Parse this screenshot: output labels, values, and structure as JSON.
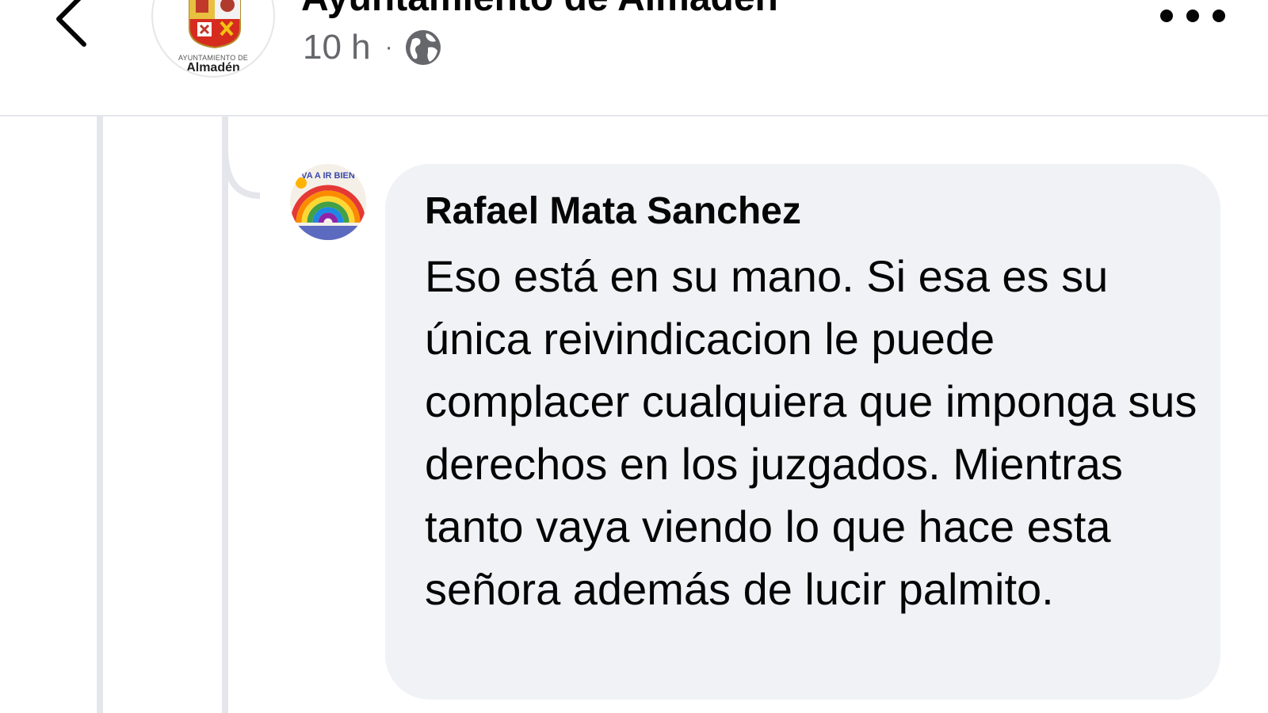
{
  "header": {
    "page_name": "Ayuntamiento de Almadén",
    "logo_caption_small": "AYUNTAMIENTO DE",
    "logo_caption_main": "Almadén",
    "time_ago": "10 h",
    "separator": "·",
    "audience_icon": "globe-icon",
    "back_icon": "chevron-left-icon",
    "more_icon": "more-horizontal-icon"
  },
  "comment": {
    "author": "Rafael Mata Sanchez",
    "text": "Eso está en su mano. Si esa es su única reivindicacion le puede complacer cualquiera que imponga sus derechos en los juzgados. Mientras tanto vaya viendo lo que hace esta señora además de lucir palmito.",
    "avatar_caption": "VA A IR BIEN"
  },
  "colors": {
    "bubble": "#f0f2f5",
    "thread_line": "#e4e6eb",
    "meta_text": "#65676b",
    "text": "#050505"
  }
}
